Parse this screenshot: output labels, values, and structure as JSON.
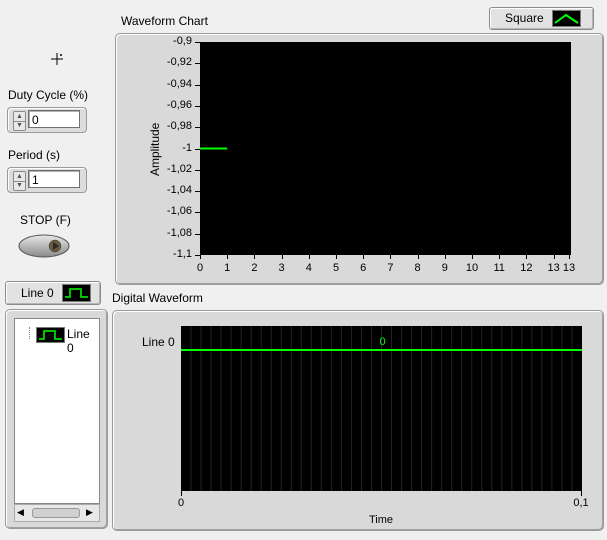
{
  "controls": {
    "duty_cycle_label": "Duty Cycle (%)",
    "duty_cycle_value": "0",
    "period_label": "Period (s)",
    "period_value": "1",
    "stop_label": "STOP  (F)"
  },
  "waveform_chart": {
    "title": "Waveform Chart",
    "ylabel": "Amplitude",
    "legend_label": "Square",
    "line_color": "#00ff00",
    "plot_background": "#000000"
  },
  "digital_waveform": {
    "title": "Digital Waveform",
    "legend_button_label": "Line 0",
    "tree_item_label": "Line 0",
    "row_label": "Line 0",
    "value_label": "0",
    "xlabel": "Time",
    "x_ticks": [
      "0",
      "0,1"
    ],
    "line_color": "#00ff00"
  },
  "chart_data": [
    {
      "type": "line",
      "title": "Waveform Chart",
      "xlabel": "",
      "ylabel": "Amplitude",
      "xlim": [
        0,
        13
      ],
      "ylim": [
        -1.1,
        -0.9
      ],
      "x_ticks": [
        "0",
        "1",
        "2",
        "3",
        "4",
        "5",
        "6",
        "7",
        "8",
        "9",
        "10",
        "11",
        "12",
        "13",
        "13"
      ],
      "y_ticks": [
        "-0,9",
        "-0,92",
        "-0,94",
        "-0,96",
        "-0,98",
        "-1",
        "-1,02",
        "-1,04",
        "-1,06",
        "-1,08",
        "-1,1"
      ],
      "series": [
        {
          "name": "Square",
          "x": [
            0,
            1
          ],
          "y": [
            -1,
            -1
          ]
        }
      ],
      "grid": false,
      "legend": "top-right"
    },
    {
      "type": "line",
      "title": "Digital Waveform",
      "xlabel": "Time",
      "xlim": [
        0,
        0.1
      ],
      "x_ticks": [
        "0",
        "0,1"
      ],
      "series": [
        {
          "name": "Line 0",
          "x": [
            0,
            0.1
          ],
          "y": [
            0,
            0
          ]
        }
      ],
      "grid": true
    }
  ]
}
